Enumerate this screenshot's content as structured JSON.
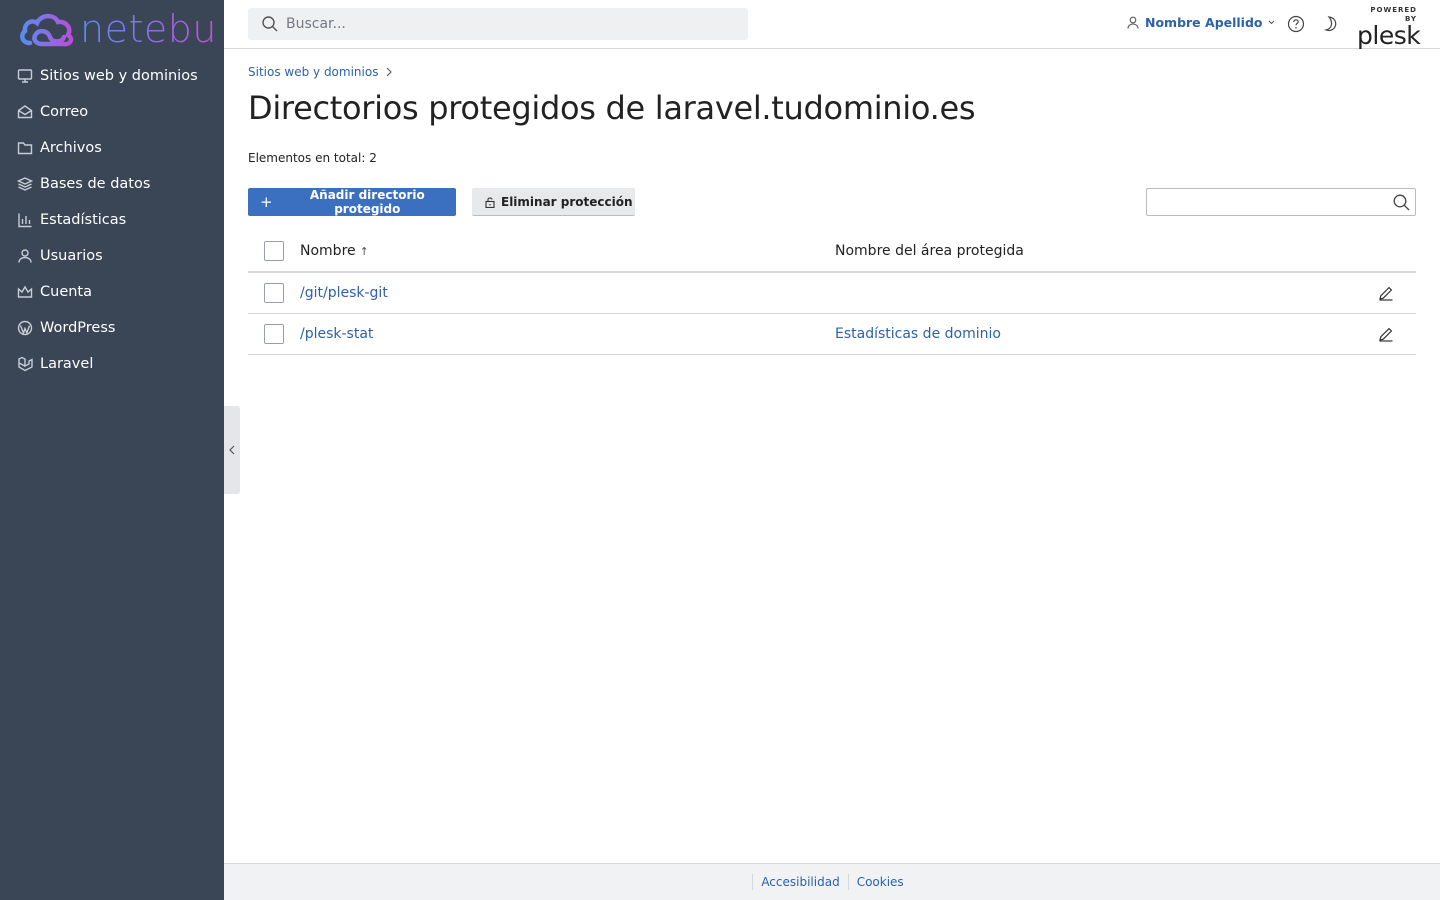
{
  "brand": {
    "name": "netebu",
    "powered_by": "POWERED BY",
    "platform": "plesk"
  },
  "sidebar": {
    "items": [
      {
        "label": "Sitios web y dominios",
        "icon": "monitor-icon"
      },
      {
        "label": "Correo",
        "icon": "mail-icon"
      },
      {
        "label": "Archivos",
        "icon": "folder-icon"
      },
      {
        "label": "Bases de datos",
        "icon": "database-icon"
      },
      {
        "label": "Estadísticas",
        "icon": "bar-chart-icon"
      },
      {
        "label": "Usuarios",
        "icon": "user-icon"
      },
      {
        "label": "Cuenta",
        "icon": "crown-icon"
      },
      {
        "label": "WordPress",
        "icon": "wordpress-icon"
      },
      {
        "label": "Laravel",
        "icon": "laravel-icon"
      }
    ]
  },
  "header": {
    "search_placeholder": "Buscar...",
    "user_name": "Nombre Apellido"
  },
  "breadcrumb": {
    "items": [
      "Sitios web y dominios"
    ]
  },
  "page": {
    "title": "Directorios protegidos de laravel.tudominio.es",
    "total_label": "Elementos en total: 2"
  },
  "toolbar": {
    "add_label": "Añadir directorio protegido",
    "remove_label": "Eliminar protección",
    "search_value": ""
  },
  "table": {
    "columns": [
      "Nombre",
      "Nombre del área protegida"
    ],
    "sort_indicator": "↑",
    "rows": [
      {
        "name": "/git/plesk-git",
        "area": ""
      },
      {
        "name": "/plesk-stat",
        "area": "Estadísticas de dominio"
      }
    ]
  },
  "footer": {
    "links": [
      "Accesibilidad",
      "Cookies"
    ]
  },
  "colors": {
    "sidebar_bg": "#3a4556",
    "link": "#2c62a8",
    "primary_button": "#3b6fbf"
  }
}
